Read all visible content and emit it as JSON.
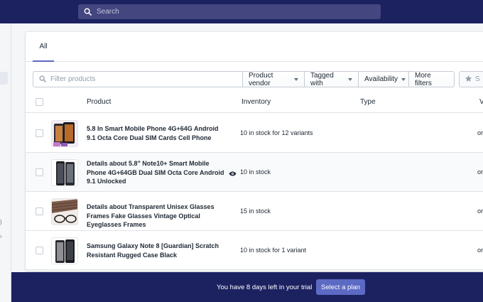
{
  "topbar": {
    "search_placeholder": "Search"
  },
  "tabs": [
    {
      "label": "All"
    }
  ],
  "filters": {
    "placeholder": "Filter products",
    "buttons": [
      "Product vendor",
      "Tagged with",
      "Availability",
      "More filters"
    ]
  },
  "table": {
    "headers": {
      "product": "Product",
      "inventory": "Inventory",
      "type": "Type",
      "vendor_partial": "V"
    },
    "rows": [
      {
        "name": "5.8 In Smart Mobile Phone 4G+64G Android 9.1 Octa Core Dual SIM Cards Cell Phone",
        "inventory": "10 in stock for 12 variants",
        "tail": "or"
      },
      {
        "name": "Details about 5.8\" Note10+ Smart Mobile Phone 4G+64GB Dual SIM Octa Core Android 9.1 Unlocked",
        "inventory": "10 in stock",
        "tail": "or"
      },
      {
        "name": "Details about Transparent Unisex Glasses Frames Fake Glasses Vintage Optical Eyeglasses Frames",
        "inventory": "15 in stock",
        "tail": "or"
      },
      {
        "name": "Samsung Galaxy Note 8 [Guardian] Scratch Resistant Rugged Case Black",
        "inventory": "10 in stock for 1 variant",
        "tail": "or"
      }
    ]
  },
  "trial": {
    "message": "You have 8 days left in your trial",
    "button": "Select a plan"
  },
  "colors": {
    "topbar": "#1c2260",
    "accent": "#5c6ac4",
    "search_bg": "#43467f"
  }
}
